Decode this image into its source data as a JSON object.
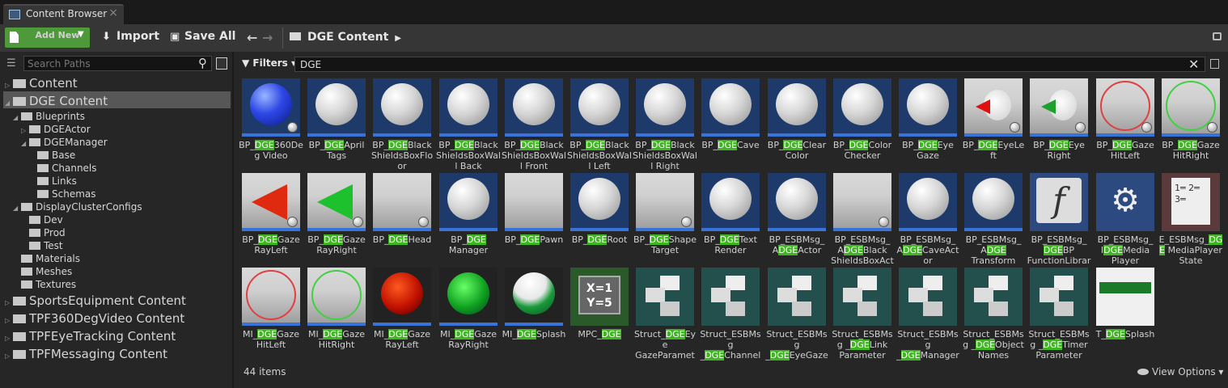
{
  "tab": {
    "title": "Content Browser",
    "close": "×"
  },
  "toolbar": {
    "add_new": "Add New",
    "import": "Import",
    "save_all": "Save All",
    "breadcrumb": "DGE Content"
  },
  "left": {
    "search_placeholder": "Search Paths",
    "tree": [
      {
        "label": "Content",
        "level": 0,
        "expand": "▷",
        "size": "big"
      },
      {
        "label": "DGE Content",
        "level": 0,
        "expand": "◢",
        "size": "big",
        "selected": true
      },
      {
        "label": "Blueprints",
        "level": 1,
        "expand": "◢",
        "size": "small"
      },
      {
        "label": "DGEActor",
        "level": 2,
        "expand": "▷",
        "size": "small"
      },
      {
        "label": "DGEManager",
        "level": 2,
        "expand": "◢",
        "size": "small"
      },
      {
        "label": "Base",
        "level": 3,
        "expand": "",
        "size": "small"
      },
      {
        "label": "Channels",
        "level": 3,
        "expand": "",
        "size": "small"
      },
      {
        "label": "Links",
        "level": 3,
        "expand": "",
        "size": "small"
      },
      {
        "label": "Schemas",
        "level": 3,
        "expand": "",
        "size": "small"
      },
      {
        "label": "DisplayClusterConfigs",
        "level": 1,
        "expand": "◢",
        "size": "small"
      },
      {
        "label": "Dev",
        "level": 2,
        "expand": "",
        "size": "small"
      },
      {
        "label": "Prod",
        "level": 2,
        "expand": "",
        "size": "small"
      },
      {
        "label": "Test",
        "level": 2,
        "expand": "",
        "size": "small"
      },
      {
        "label": "Materials",
        "level": 1,
        "expand": "",
        "size": "small"
      },
      {
        "label": "Meshes",
        "level": 1,
        "expand": "",
        "size": "small"
      },
      {
        "label": "Textures",
        "level": 1,
        "expand": "",
        "size": "small"
      },
      {
        "label": "SportsEquipment Content",
        "level": 0,
        "expand": "▷",
        "size": "big"
      },
      {
        "label": "TPF360DegVideo Content",
        "level": 0,
        "expand": "▷",
        "size": "big"
      },
      {
        "label": "TPFEyeTracking Content",
        "level": 0,
        "expand": "▷",
        "size": "big"
      },
      {
        "label": "TPFMessaging Content",
        "level": 0,
        "expand": "▷",
        "size": "big"
      }
    ]
  },
  "right": {
    "filters_label": "Filters",
    "search_value": "DGE",
    "item_count": "44 items",
    "view_options": "View Options"
  },
  "assets": [
    {
      "pre": "BP_",
      "hl": "DGE",
      "post": "360Deg Video",
      "kind": "bluesphere",
      "badge": true
    },
    {
      "pre": "BP_",
      "hl": "DGE",
      "post": "April Tags",
      "kind": "sphere"
    },
    {
      "pre": "BP_",
      "hl": "DGE",
      "post": "Black ShieldsBoxFloor",
      "kind": "sphere"
    },
    {
      "pre": "BP_",
      "hl": "DGE",
      "post": "Black ShieldsBoxWall Back",
      "kind": "sphere"
    },
    {
      "pre": "BP_",
      "hl": "DGE",
      "post": "Black ShieldsBoxWall Front",
      "kind": "sphere"
    },
    {
      "pre": "BP_",
      "hl": "DGE",
      "post": "Black ShieldsBoxWall Left",
      "kind": "sphere"
    },
    {
      "pre": "BP_",
      "hl": "DGE",
      "post": "Black ShieldsBoxWall Right",
      "kind": "sphere"
    },
    {
      "pre": "BP_",
      "hl": "DGE",
      "post": "Cave",
      "kind": "sphere"
    },
    {
      "pre": "BP_",
      "hl": "DGE",
      "post": "Clear Color",
      "kind": "sphere"
    },
    {
      "pre": "BP_",
      "hl": "DGE",
      "post": "Color Checker",
      "kind": "sphere"
    },
    {
      "pre": "BP_",
      "hl": "DGE",
      "post": "Eye Gaze",
      "kind": "sphere"
    },
    {
      "pre": "BP_",
      "hl": "DGE",
      "post": "EyeLeft",
      "kind": "eye-red",
      "badge": true
    },
    {
      "pre": "BP_",
      "hl": "DGE",
      "post": "Eye Right",
      "kind": "eye-green",
      "badge": true
    },
    {
      "pre": "BP_",
      "hl": "DGE",
      "post": "Gaze HitLeft",
      "kind": "ring-red",
      "badge": true
    },
    {
      "pre": "BP_",
      "hl": "DGE",
      "post": "Gaze HitRight",
      "kind": "ring-green",
      "badge": true
    },
    {
      "pre": "BP_",
      "hl": "DGE",
      "post": "Gaze RayLeft",
      "kind": "cone-red",
      "badge": true
    },
    {
      "pre": "BP_",
      "hl": "DGE",
      "post": "Gaze RayRight",
      "kind": "cone-green",
      "badge": true
    },
    {
      "pre": "BP_",
      "hl": "DGE",
      "post": "Head",
      "kind": "grid",
      "badge": true
    },
    {
      "pre": "BP_",
      "hl": "DGE",
      "post": " Manager",
      "kind": "sphere"
    },
    {
      "pre": "BP_",
      "hl": "DGE",
      "post": "Pawn",
      "kind": "grid"
    },
    {
      "pre": "BP_",
      "hl": "DGE",
      "post": "Root",
      "kind": "sphere"
    },
    {
      "pre": "BP_",
      "hl": "DGE",
      "post": "Shape Target",
      "kind": "grid",
      "badge": true
    },
    {
      "pre": "BP_",
      "hl": "DGE",
      "post": "Text Render",
      "kind": "sphere"
    },
    {
      "pre": "BP_ESBMsg_ A",
      "hl": "DGE",
      "post": "Actor",
      "kind": "sphere"
    },
    {
      "pre": "BP_ESBMsg_ A",
      "hl": "DGE",
      "post": "Black ShieldsBoxActor",
      "kind": "grid",
      "badge": true
    },
    {
      "pre": "BP_ESBMsg_ A",
      "hl": "DGE",
      "post": "CaveActor",
      "kind": "sphere"
    },
    {
      "pre": "BP_ESBMsg_ A",
      "hl": "DGE",
      "post": " Transform",
      "kind": "sphere"
    },
    {
      "pre": "BP_ESBMsg_ ",
      "hl": "DGE",
      "post": "BP FunctionLibrary",
      "kind": "func"
    },
    {
      "pre": "BP_ESBMsg_ I",
      "hl": "DGE",
      "post": "Media Player",
      "kind": "gear"
    },
    {
      "pre": "E_ESBMsg_",
      "hl": "DGE",
      "post": " MediaPlayer State",
      "kind": "enum"
    },
    {
      "pre": "MI_",
      "hl": "DGE",
      "post": "Gaze HitLeft",
      "kind": "mi-ring-red"
    },
    {
      "pre": "MI_",
      "hl": "DGE",
      "post": "Gaze HitRight",
      "kind": "mi-ring-green"
    },
    {
      "pre": "MI_",
      "hl": "DGE",
      "post": "Gaze RayLeft",
      "kind": "mi-red"
    },
    {
      "pre": "MI_",
      "hl": "DGE",
      "post": "Gaze RayRight",
      "kind": "mi-green"
    },
    {
      "pre": "MI_",
      "hl": "DGE",
      "post": "Splash",
      "kind": "splash"
    },
    {
      "pre": "MPC_",
      "hl": "DGE",
      "post": "",
      "kind": "mpc"
    },
    {
      "pre": "Struct_",
      "hl": "DGE",
      "post": "Eye GazeParameter",
      "kind": "struct"
    },
    {
      "pre": "Struct_ESBMsg _",
      "hl": "DGE",
      "post": "Channel Parameter",
      "kind": "struct"
    },
    {
      "pre": "Struct_ESBMsg _",
      "hl": "DGE",
      "post": "EyeGaze Hit",
      "kind": "struct"
    },
    {
      "pre": "Struct_ESBMsg _",
      "hl": "DGE",
      "post": "Link Parameter",
      "kind": "struct"
    },
    {
      "pre": "Struct_ESBMsg _",
      "hl": "DGE",
      "post": "Manager Messages",
      "kind": "struct"
    },
    {
      "pre": "Struct_ESBMsg _",
      "hl": "DGE",
      "post": "Object Names",
      "kind": "struct"
    },
    {
      "pre": "Struct_ESBMsg _",
      "hl": "DGE",
      "post": "Timer Parameter",
      "kind": "struct"
    },
    {
      "pre": "T_",
      "hl": "DGE",
      "post": "Splash",
      "kind": "texture"
    }
  ]
}
